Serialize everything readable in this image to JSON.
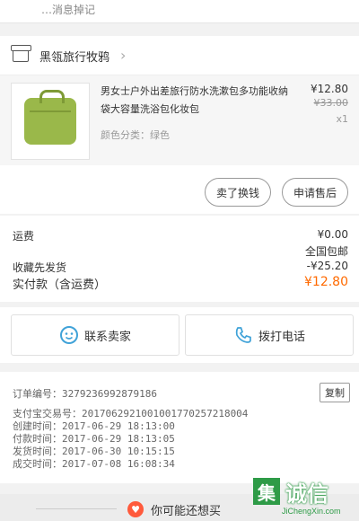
{
  "top_partial_text": "…消息掉记",
  "store": {
    "name": "黑瓴旅行牧鸦"
  },
  "product": {
    "title": "男女士户外出差旅行防水洗漱包多功能收纳袋大容量洗浴包化妆包",
    "spec": "颜色分类：绿色",
    "price": "¥12.80",
    "original_price": "¥33.00",
    "quantity": "x1"
  },
  "item_actions": {
    "exchange_label": "卖了换钱",
    "aftersale_label": "申请售后"
  },
  "costs": {
    "shipping_label": "运费",
    "shipping_value": "¥0.00",
    "shipping_note": "全国包邮",
    "discount_label": "收藏先发货",
    "discount_value": "-¥25.20",
    "total_label": "实付款（含运费）",
    "total_value": "¥12.80"
  },
  "contact": {
    "seller_label": "联系卖家",
    "phone_label": "拨打电话"
  },
  "order_info": {
    "order_no": "订单编号：327923699287918​6",
    "alipay_no": "支付宝交易号：2017062921001001770257218004",
    "created": "创建时间：2017-06-29 18:13:00",
    "paid": "付款时间：2017-06-29 18:13:05",
    "shipped": "发货时间：2017-06-30 10:15:15",
    "completed": "成交时间：2017-07-08 16:08:34",
    "copy_label": "复制"
  },
  "recommend": {
    "label": "你可能还想买"
  },
  "watermark": {
    "box_char": "集",
    "big": "诚信",
    "small": "JiChengXin.com"
  },
  "colors": {
    "accent_price": "#ff6a00",
    "contact_icon": "#3fa2d8",
    "watermark_green": "#2e9b47"
  }
}
